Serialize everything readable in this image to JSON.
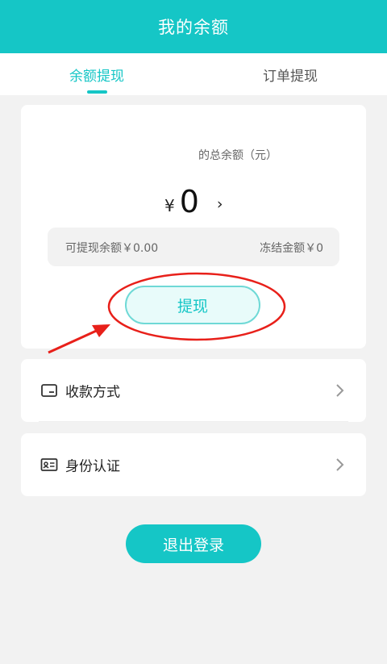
{
  "header": {
    "title": "我的余额"
  },
  "tabs": [
    {
      "label": "余额提现",
      "active": true
    },
    {
      "label": "订单提现",
      "active": false
    }
  ],
  "balance": {
    "total_label": "的总余额（元）",
    "currency": "¥",
    "amount": "0",
    "chevron": "›",
    "withdrawable": "可提现余额￥0.00",
    "frozen": "冻结金额￥0"
  },
  "actions": {
    "withdraw_label": "提现",
    "logout_label": "退出登录"
  },
  "menu": [
    {
      "label": "收款方式",
      "icon": "wallet-icon"
    },
    {
      "label": "身份认证",
      "icon": "id-card-icon"
    }
  ],
  "colors": {
    "accent": "#15c6c6",
    "annotation": "#e8201a",
    "background": "#f2f2f2"
  }
}
